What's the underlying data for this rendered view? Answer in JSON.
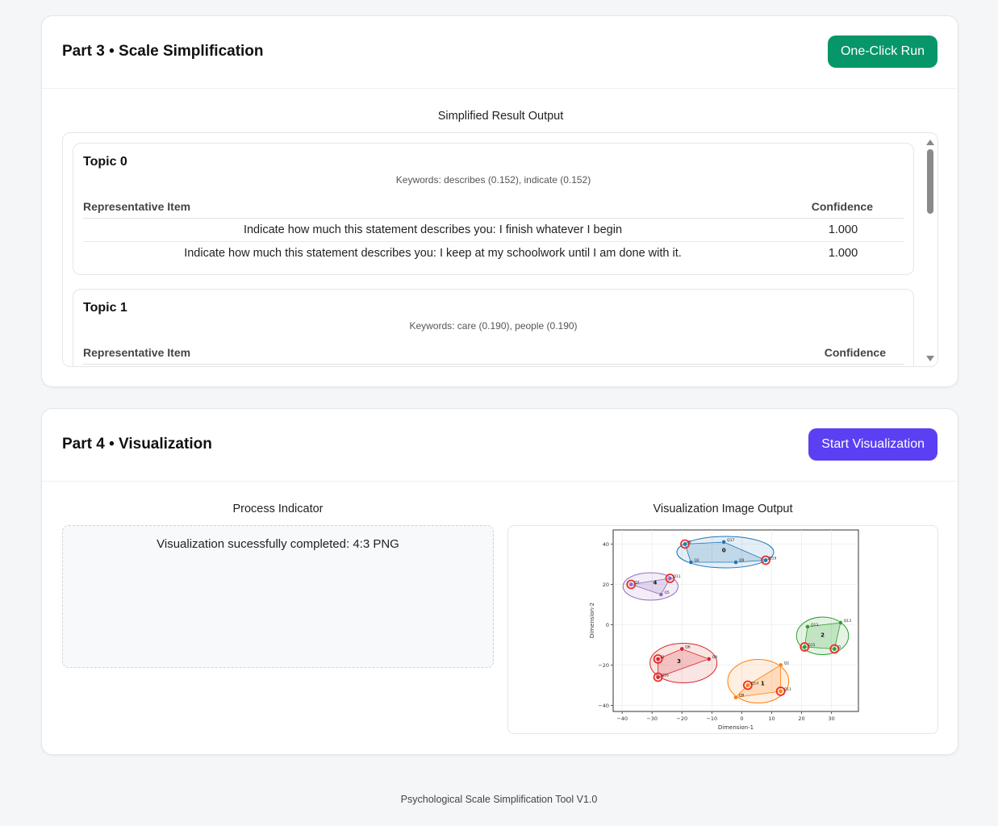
{
  "part3": {
    "title": "Part 3 • Scale Simplification",
    "run_button": "One-Click Run",
    "output_label": "Simplified Result Output",
    "topics": [
      {
        "name": "Topic 0",
        "keywords": "Keywords: describes (0.152), indicate (0.152)",
        "col_item": "Representative Item",
        "col_confidence": "Confidence",
        "rows": [
          {
            "item": "Indicate how much this statement describes you: I finish whatever I begin",
            "confidence": "1.000"
          },
          {
            "item": "Indicate how much this statement describes you: I keep at my schoolwork until I am done with it.",
            "confidence": "1.000"
          }
        ]
      },
      {
        "name": "Topic 1",
        "keywords": "Keywords: care (0.190), people (0.190)",
        "col_item": "Representative Item",
        "col_confidence": "Confidence"
      }
    ]
  },
  "part4": {
    "title": "Part 4 • Visualization",
    "start_button": "Start Visualization",
    "process_label": "Process Indicator",
    "process_message": "Visualization sucessfully completed: 4:3 PNG",
    "image_label": "Visualization Image Output"
  },
  "footer": "Psychological Scale Simplification Tool V1.0",
  "colors": {
    "green_button": "#079669",
    "purple_button": "#5a3ff3",
    "cluster_0": "#1f77b4",
    "cluster_1": "#ff7f0e",
    "cluster_2": "#2ca02c",
    "cluster_3": "#d62728",
    "cluster_4": "#9467bd",
    "highlight": "#e8302a"
  },
  "chart_data": {
    "type": "scatter",
    "title": "",
    "xlabel": "Dimension-1",
    "ylabel": "Dimension-2",
    "xlim": [
      -43,
      39
    ],
    "ylim": [
      -43,
      47
    ],
    "xticks": [
      -40,
      -30,
      -20,
      -10,
      0,
      10,
      20,
      30
    ],
    "yticks": [
      -40,
      -20,
      0,
      20,
      40
    ],
    "xtick_labels": [
      "−40",
      "−30",
      "−20",
      "−10",
      "0",
      "10",
      "20",
      "30"
    ],
    "ytick_labels": [
      "−40",
      "−20",
      "0",
      "20",
      "40"
    ],
    "grid": true,
    "clusters": [
      {
        "label": "0",
        "color": "#1f77b4",
        "center": [
          -6,
          37
        ],
        "points": [
          {
            "x": -19,
            "y": 40,
            "label": "Q",
            "highlight": true
          },
          {
            "x": -6,
            "y": 41,
            "label": "Q17",
            "highlight": false
          },
          {
            "x": -17,
            "y": 31,
            "label": "Q2",
            "highlight": false
          },
          {
            "x": -2,
            "y": 31,
            "label": "Q9",
            "highlight": false
          },
          {
            "x": 8,
            "y": 32,
            "label": "Q19",
            "highlight": true
          }
        ]
      },
      {
        "label": "1",
        "color": "#ff7f0e",
        "center": [
          7,
          -29
        ],
        "points": [
          {
            "x": 13,
            "y": -20,
            "label": "Q2",
            "highlight": false
          },
          {
            "x": 2,
            "y": -30,
            "label": "Q14",
            "highlight": true
          },
          {
            "x": 13,
            "y": -33,
            "label": "Q11",
            "highlight": true
          },
          {
            "x": -2,
            "y": -36,
            "label": "Q8",
            "highlight": false
          }
        ]
      },
      {
        "label": "2",
        "color": "#2ca02c",
        "center": [
          27,
          -5
        ],
        "points": [
          {
            "x": 22,
            "y": -1,
            "label": "Q13",
            "highlight": false
          },
          {
            "x": 33,
            "y": 1,
            "label": "Q13",
            "highlight": false
          },
          {
            "x": 21,
            "y": -11,
            "label": "Q15",
            "highlight": true
          },
          {
            "x": 31,
            "y": -12,
            "label": "Q",
            "highlight": true
          }
        ]
      },
      {
        "label": "3",
        "color": "#d62728",
        "center": [
          -21,
          -18
        ],
        "points": [
          {
            "x": -20,
            "y": -12,
            "label": "Q6",
            "highlight": false
          },
          {
            "x": -11,
            "y": -17,
            "label": "Q8",
            "highlight": false
          },
          {
            "x": -28,
            "y": -17,
            "label": "Q",
            "highlight": true
          },
          {
            "x": -28,
            "y": -26,
            "label": "Q16",
            "highlight": true
          }
        ]
      },
      {
        "label": "4",
        "color": "#9467bd",
        "center": [
          -29,
          21
        ],
        "points": [
          {
            "x": -24,
            "y": 23,
            "label": "Q11",
            "highlight": true
          },
          {
            "x": -37,
            "y": 20,
            "label": "Q2",
            "highlight": true
          },
          {
            "x": -27,
            "y": 15,
            "label": "Q5",
            "highlight": false
          }
        ]
      }
    ]
  }
}
